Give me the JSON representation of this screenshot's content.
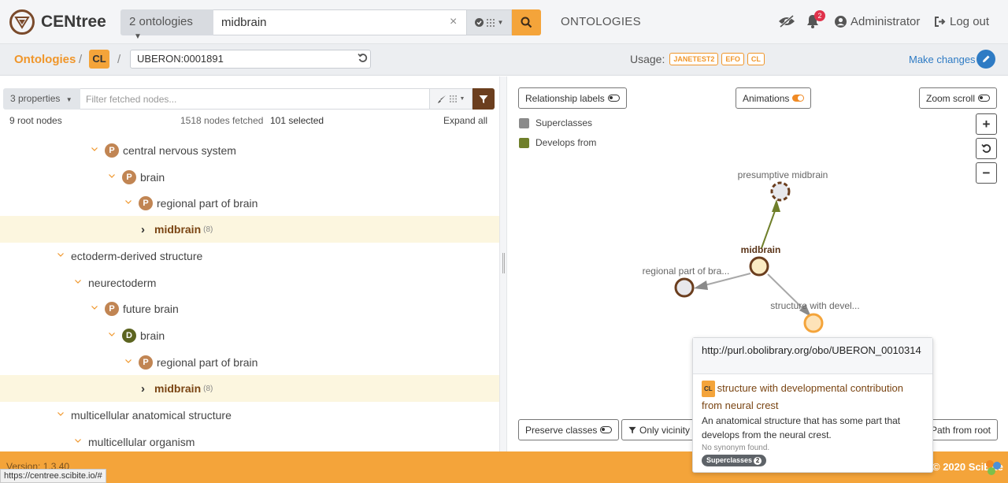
{
  "header": {
    "app_name": "CENtree",
    "ontology_select": "2 ontologies",
    "search_value": "midbrain",
    "clear_icon": "×",
    "nav_ontologies": "ONTOLOGIES",
    "notification_count": "2",
    "user": "Administrator",
    "logout": "Log out"
  },
  "breadcrumb": {
    "root": "Ontologies",
    "ontology": "CL",
    "term_id": "UBERON:0001891",
    "usage_label": "Usage:",
    "usage_badges": [
      "JANETEST2",
      "EFO",
      "CL"
    ],
    "make_changes": "Make changes"
  },
  "tree_panel": {
    "properties_select": "3 properties",
    "filter_placeholder": "Filter fetched nodes...",
    "root_nodes": "9 root nodes",
    "fetched": "1518 nodes fetched",
    "selected": "101 selected",
    "expand_all": "Expand all",
    "rows": [
      {
        "label": "central nervous system",
        "badge": "P"
      },
      {
        "label": "brain",
        "badge": "P"
      },
      {
        "label": "regional part of brain",
        "badge": "P"
      },
      {
        "label": "midbrain",
        "count": "(8)"
      },
      {
        "label": "ectoderm-derived structure"
      },
      {
        "label": "neurectoderm"
      },
      {
        "label": "future brain",
        "badge": "P"
      },
      {
        "label": "brain",
        "badge": "D"
      },
      {
        "label": "regional part of brain",
        "badge": "P"
      },
      {
        "label": "midbrain",
        "count": "(8)"
      },
      {
        "label": "multicellular anatomical structure"
      },
      {
        "label": "multicellular organism"
      }
    ]
  },
  "graph_panel": {
    "relationship_labels": "Relationship labels",
    "animations": "Animations",
    "zoom_scroll": "Zoom scroll",
    "legend": [
      {
        "label": "Superclasses",
        "color": "#8a8a8a"
      },
      {
        "label": "Develops from",
        "color": "#6f7f2a"
      }
    ],
    "nodes": {
      "presumptive": "presumptive midbrain",
      "midbrain": "midbrain",
      "regional": "regional part of bra...",
      "structure": "structure with devel..."
    },
    "preserve_classes": "Preserve classes",
    "only_vicinity": "Only vicinity",
    "path_from_root": "Path from root"
  },
  "tooltip": {
    "iri": "http://purl.obolibrary.org/obo/UBERON_0010314",
    "ontology_tag": "CL",
    "title": "structure with developmental contribution from neural crest",
    "description": "An anatomical structure that has some part that develops from the neural crest.",
    "synonyms": "No synonym found.",
    "superclasses_label": "Superclasses",
    "superclasses_count": "2"
  },
  "footer": {
    "version": "Version: 1.3.40",
    "copyright": "© 2020 SciBite",
    "status_url": "https://centree.scibite.io/#"
  },
  "colors": {
    "accent": "#f4a43a",
    "brand_brown": "#6b3e1e",
    "link_blue": "#2e7bc4",
    "highlight_row": "#fcf6df"
  }
}
